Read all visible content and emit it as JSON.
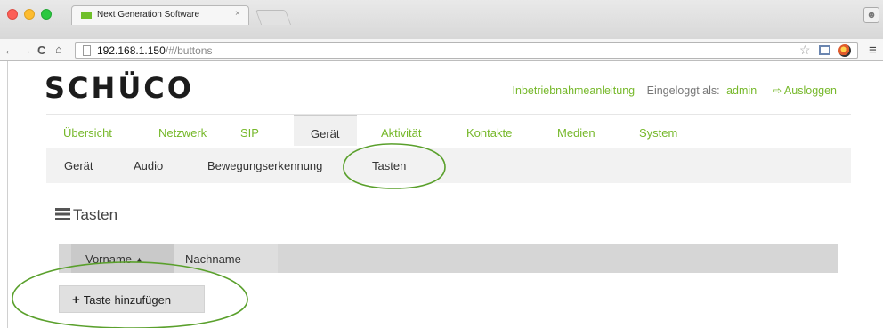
{
  "browser": {
    "tab_title": "Next Generation Software",
    "tab_close": "×",
    "profile_icon": "person-icon",
    "nav": {
      "back": "←",
      "forward": "→",
      "reload": "C",
      "home": "⌂"
    },
    "url_host": "192.168.1.150",
    "url_path": "/#/buttons",
    "bookmark_star": "☆",
    "menu": "≡"
  },
  "header": {
    "logo": "SCHÜCO",
    "manual_link": "Inbetriebnahmeanleitung",
    "logged_in_label": "Eingeloggt als:",
    "username": "admin",
    "logout_icon": "⇨",
    "logout_label": "Ausloggen"
  },
  "main_nav": {
    "items": [
      {
        "label": "Übersicht"
      },
      {
        "label": "Netzwerk"
      },
      {
        "label": "SIP"
      },
      {
        "label": "Gerät"
      },
      {
        "label": "Aktivität"
      },
      {
        "label": "Kontakte"
      },
      {
        "label": "Medien"
      },
      {
        "label": "System"
      }
    ],
    "active": "Gerät"
  },
  "sub_nav": {
    "items": [
      {
        "label": "Gerät"
      },
      {
        "label": "Audio"
      },
      {
        "label": "Bewegungserkennung"
      },
      {
        "label": "Tasten"
      }
    ],
    "active": "Tasten"
  },
  "page": {
    "title": "Tasten",
    "title_icon": "list-icon"
  },
  "table": {
    "columns": [
      {
        "label": "Vorname",
        "sort": "▲"
      },
      {
        "label": "Nachname"
      }
    ]
  },
  "actions": {
    "add_icon": "+",
    "add_label": "Taste hinzufügen"
  },
  "colors": {
    "accent_green": "#76b82a",
    "annotation_green": "#5aa02c",
    "subnav_bg": "#f2f2f2",
    "table_header_bg": "#d6d6d6"
  }
}
